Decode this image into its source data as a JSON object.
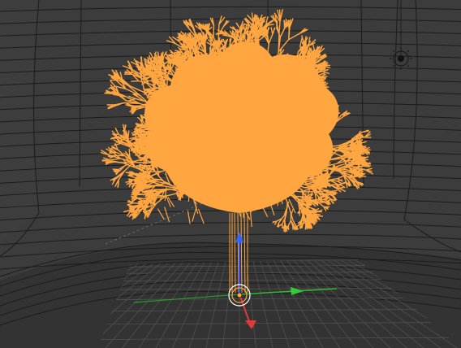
{
  "viewport": {
    "background": "#3b3b3b",
    "backdrop_color": "#303030",
    "wire_color": "#1c1c1c",
    "floor_grid_color": "#555555",
    "selection_color": "#ffa640",
    "axis_x_color": "#e03b3b",
    "axis_y_color": "#33bb33",
    "axis_z_color": "#3355ee"
  },
  "object": {
    "type": "tree-mesh",
    "selected": true
  },
  "icons": {
    "lamp": "lamp-icon",
    "gizmo": "transform-gizmo",
    "origin": "object-origin-icon"
  }
}
